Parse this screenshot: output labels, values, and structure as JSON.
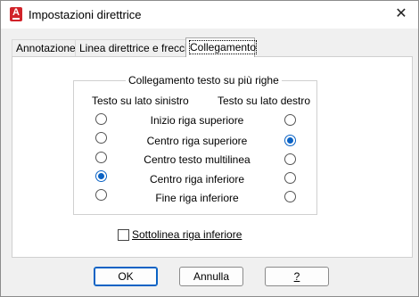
{
  "window": {
    "title": "Impostazioni direttrice",
    "close_glyph": "✕",
    "app_icon_letter": "A"
  },
  "tabs": [
    {
      "label": "Annotazione",
      "active": false
    },
    {
      "label": "Linea direttrice e freccia",
      "active": false
    },
    {
      "label": "Collegamento",
      "active": true
    }
  ],
  "group": {
    "title": "Collegamento testo su più righe",
    "left_heading": "Testo su lato sinistro",
    "right_heading": "Testo su lato destro",
    "options": [
      {
        "label": "Inizio riga superiore",
        "left": false,
        "right": false
      },
      {
        "label": "Centro riga superiore",
        "left": false,
        "right": true
      },
      {
        "label": "Centro testo multilinea",
        "left": false,
        "right": false
      },
      {
        "label": "Centro riga inferiore",
        "left": true,
        "right": false
      },
      {
        "label": "Fine riga inferiore",
        "left": false,
        "right": false
      }
    ]
  },
  "underline_checkbox": {
    "label": "Sottolinea riga inferiore",
    "checked": false
  },
  "buttons": {
    "ok": "OK",
    "cancel": "Annulla",
    "help": "?"
  },
  "colors": {
    "accent": "#0a62c4",
    "app_icon": "#d1232a"
  }
}
